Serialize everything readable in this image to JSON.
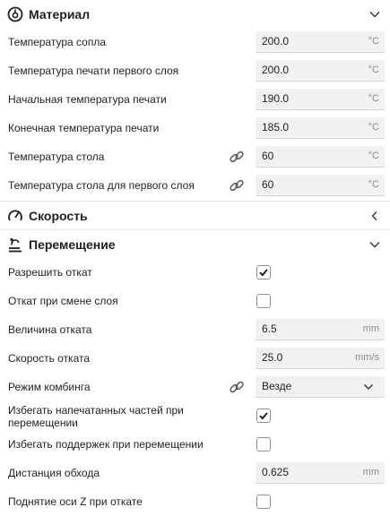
{
  "material": {
    "title": "Материал",
    "rows": [
      {
        "label": "Температура сопла",
        "value": "200.0",
        "unit": "°C"
      },
      {
        "label": "Температура печати первого слоя",
        "value": "200.0",
        "unit": "°C"
      },
      {
        "label": "Начальная температура печати",
        "value": "190.0",
        "unit": "°C"
      },
      {
        "label": "Конечная температура печати",
        "value": "185.0",
        "unit": "°C"
      },
      {
        "label": "Температура стола",
        "value": "60",
        "unit": "°C"
      },
      {
        "label": "Температура стола для первого слоя",
        "value": "60",
        "unit": "°C"
      }
    ]
  },
  "speed": {
    "title": "Скорость"
  },
  "travel": {
    "title": "Перемещение",
    "retraction_enabled": {
      "label": "Разрешить откат",
      "checked": true
    },
    "retract_layer_change": {
      "label": "Откат при смене слоя",
      "checked": false
    },
    "retraction_distance": {
      "label": "Величина отката",
      "value": "6.5",
      "unit": "mm"
    },
    "retraction_speed": {
      "label": "Скорость отката",
      "value": "25.0",
      "unit": "mm/s"
    },
    "combing_mode": {
      "label": "Режим комбинга",
      "value": "Везде"
    },
    "avoid_printed_parts": {
      "label_line1": "Избегать напечатанных частей при",
      "label_line2": "перемещении",
      "checked": true
    },
    "avoid_supports": {
      "label": "Избегать поддержек при перемещении",
      "checked": false
    },
    "avoid_distance": {
      "label": "Дистанция обхода",
      "value": "0.625",
      "unit": "mm"
    },
    "z_hop": {
      "label": "Поднятие оси Z при откате",
      "checked": false
    }
  },
  "colors": {
    "text": "#1f1f1f",
    "field_bg": "#f1f1f1",
    "unit": "#8a8a8a",
    "separator": "#e3e3e3"
  },
  "icons": [
    "material-icon",
    "speed-icon",
    "travel-icon",
    "link-icon",
    "chevron-down-icon",
    "chevron-left-icon",
    "checkmark-icon"
  ]
}
